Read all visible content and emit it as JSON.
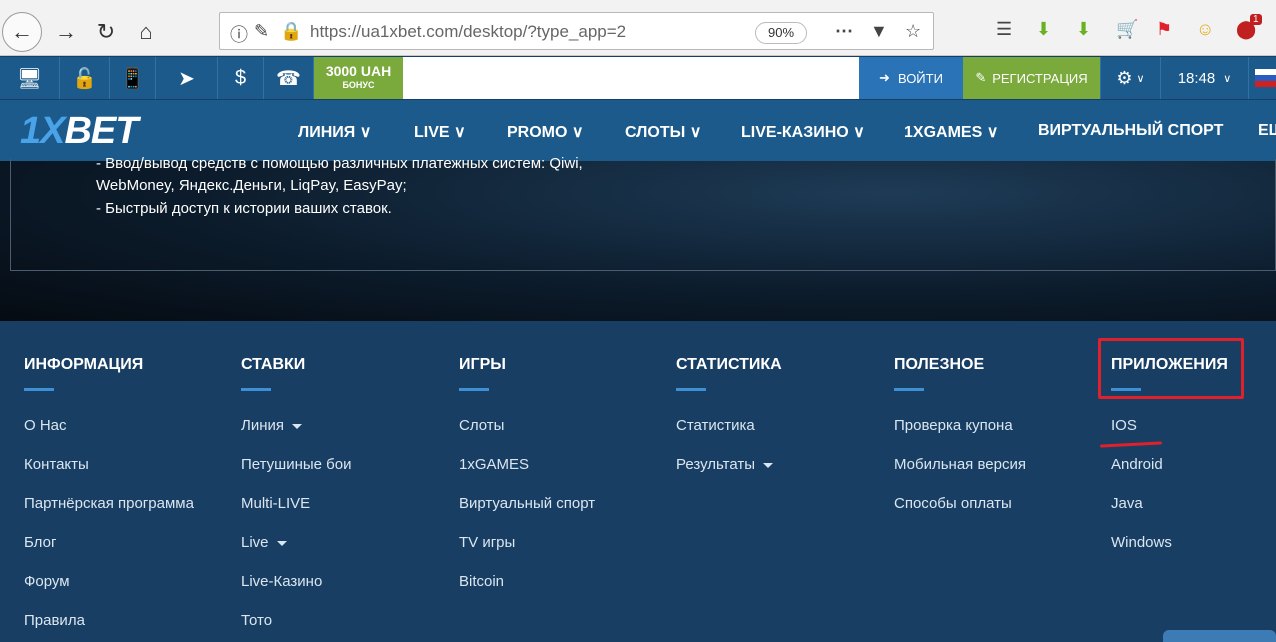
{
  "browser": {
    "url": "https://ua1xbet.com/desktop/?type_app=2",
    "zoom": "90%",
    "badge": "1"
  },
  "topbar": {
    "bonus_amount": "3000 UAH",
    "bonus_label": "БОНУС",
    "login": "ВОЙТИ",
    "register": "РЕГИСТРАЦИЯ",
    "time": "18:48"
  },
  "logo": {
    "part1": "1X",
    "part2": "BET"
  },
  "nav": [
    "ЛИНИЯ",
    "LIVE",
    "PROMO",
    "СЛОТЫ",
    "LIVE-КАЗИНО",
    "1XGAMES",
    "ВИРТУАЛЬНЫЙ СПОРТ",
    "ЕЩ"
  ],
  "hero_lines": [
    "- Ввод/вывод средств с помощью различных платежных систем: Qiwi,",
    "WebMoney, Яндекс.Деньги, LiqPay, EasyPay;",
    "- Быстрый доступ к истории ваших ставок."
  ],
  "footer": {
    "columns": [
      {
        "title": "ИНФОРМАЦИЯ",
        "links": [
          "О Нас",
          "Контакты",
          "Партнёрская программа",
          "Блог",
          "Форум",
          "Правила"
        ]
      },
      {
        "title": "СТАВКИ",
        "links": [
          "Линия",
          "Петушиные бои",
          "Multi-LIVE",
          "Live",
          "Live-Казино",
          "Тото"
        ]
      },
      {
        "title": "ИГРЫ",
        "links": [
          "Слоты",
          "1xGAMES",
          "Виртуальный спорт",
          "TV игры",
          "Bitcoin"
        ]
      },
      {
        "title": "СТАТИСТИКА",
        "links": [
          "Статистика",
          "Результаты"
        ]
      },
      {
        "title": "ПОЛЕЗНОЕ",
        "links": [
          "Проверка купона",
          "Мобильная версия",
          "Способы оплаты"
        ]
      },
      {
        "title": "ПРИЛОЖЕНИЯ",
        "links": [
          "IOS",
          "Android",
          "Java",
          "Windows"
        ]
      }
    ]
  },
  "colors": {
    "header_blue": "#1b5a8a",
    "footer_blue": "#183e63",
    "green": "#7aa93c",
    "login_blue": "#2a73b6",
    "highlight_red": "#e0202a",
    "accent_line": "#3d8fd6"
  }
}
